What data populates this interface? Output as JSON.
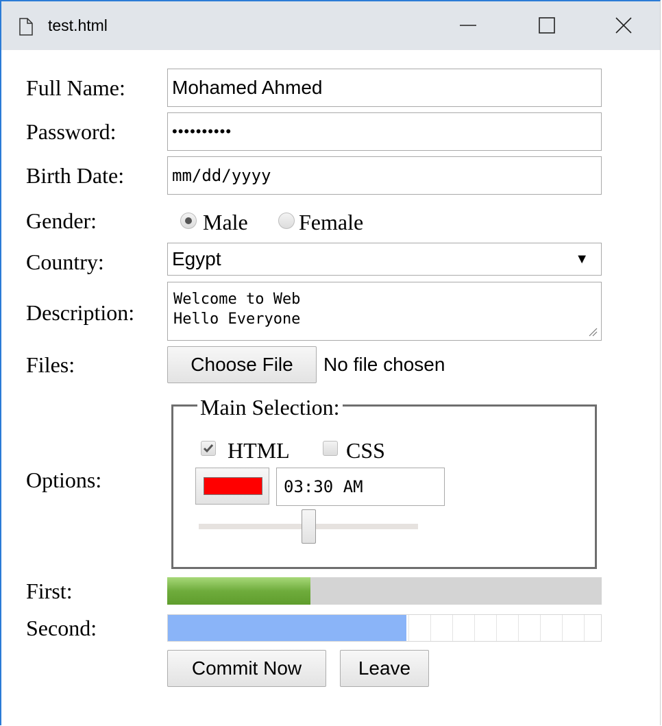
{
  "window": {
    "title": "test.html",
    "accent_color": "#2b7bd6"
  },
  "form": {
    "full_name": {
      "label": "Full Name:",
      "value": "Mohamed Ahmed"
    },
    "password": {
      "label": "Password:",
      "value": "••••••••••"
    },
    "birth_date": {
      "label": "Birth Date:",
      "placeholder": "mm/dd/yyyy"
    },
    "gender": {
      "label": "Gender:",
      "options": [
        {
          "label": "Male",
          "checked": true
        },
        {
          "label": "Female",
          "checked": false
        }
      ]
    },
    "country": {
      "label": "Country:",
      "selected": "Egypt"
    },
    "description": {
      "label": "Description:",
      "value": "Welcome to Web\nHello Everyone"
    },
    "files": {
      "label": "Files:",
      "button_label": "Choose File",
      "status": "No file chosen"
    },
    "options": {
      "label": "Options:",
      "legend": "Main Selection:",
      "checkboxes": [
        {
          "label": "HTML",
          "checked": true
        },
        {
          "label": "CSS",
          "checked": false
        }
      ],
      "color": "#ff0000",
      "time": "03:30 AM",
      "range_fraction": 0.5
    },
    "first": {
      "label": "First:",
      "fraction": 0.33,
      "color": "#6fac3c"
    },
    "second": {
      "label": "Second:",
      "fraction": 0.55,
      "color": "#8ab4f8"
    },
    "buttons": {
      "commit": "Commit Now",
      "leave": "Leave"
    }
  }
}
